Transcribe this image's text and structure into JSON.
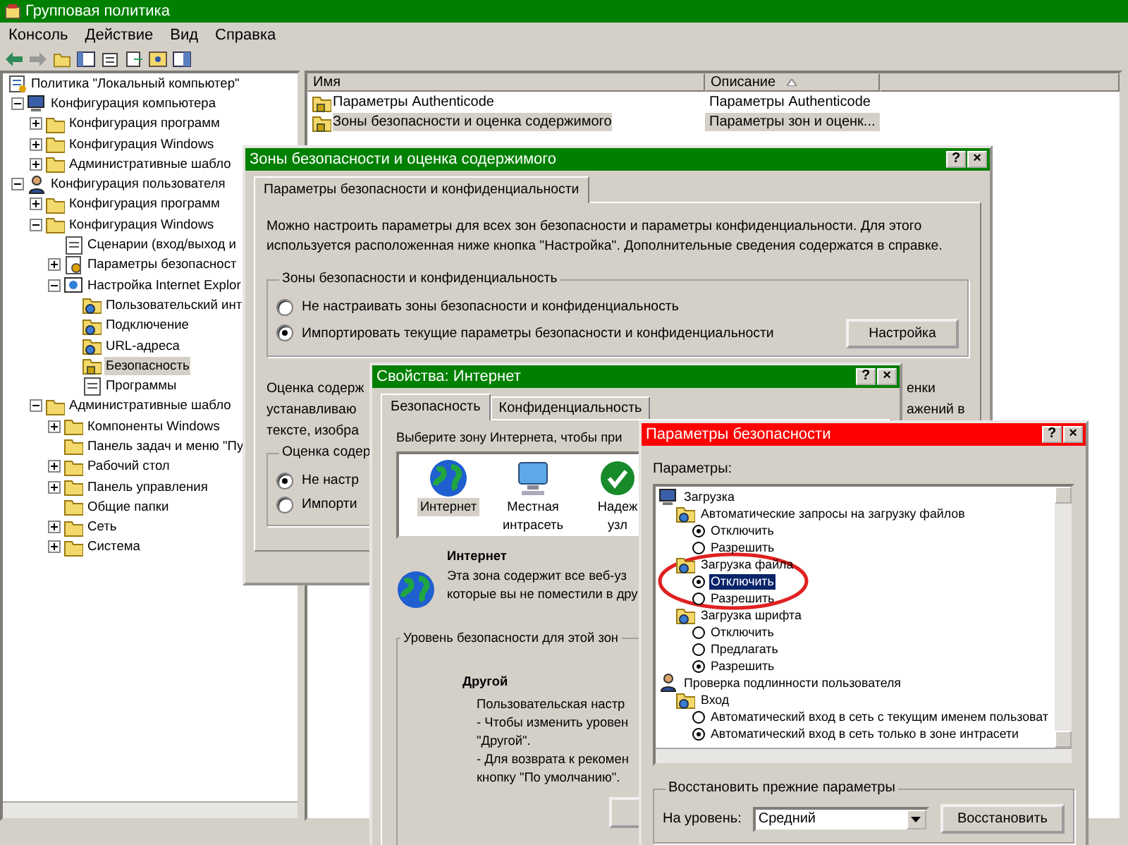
{
  "window": {
    "title": "Групповая политика"
  },
  "menu": [
    "Консоль",
    "Действие",
    "Вид",
    "Справка"
  ],
  "tree": [
    {
      "label": "Политика \"Локальный компьютер\"",
      "children": [
        {
          "label": "Конфигурация компьютера",
          "expanded": true,
          "children": [
            {
              "label": "Конфигурация программ",
              "expanded": false
            },
            {
              "label": "Конфигурация Windows",
              "expanded": false
            },
            {
              "label": "Административные шабло",
              "expanded": false
            }
          ]
        },
        {
          "label": "Конфигурация пользователя",
          "expanded": true,
          "children": [
            {
              "label": "Конфигурация программ",
              "expanded": false
            },
            {
              "label": "Конфигурация Windows",
              "expanded": true,
              "children": [
                {
                  "label": "Сценарии (вход/выход и"
                },
                {
                  "label": "Параметры безопасност",
                  "expanded": false
                },
                {
                  "label": "Настройка Internet Explor",
                  "expanded": true,
                  "children": [
                    {
                      "label": "Пользовательский инт",
                      "selected": false
                    },
                    {
                      "label": "Подключение",
                      "selected": false
                    },
                    {
                      "label": "URL-адреса",
                      "selected": false
                    },
                    {
                      "label": "Безопасность",
                      "selected": true
                    },
                    {
                      "label": "Программы",
                      "selected": false
                    }
                  ]
                }
              ]
            },
            {
              "label": "Административные шабло",
              "expanded": true,
              "children": [
                {
                  "label": "Компоненты Windows",
                  "expanded": false
                },
                {
                  "label": "Панель задач и меню \"Пу"
                },
                {
                  "label": "Рабочий стол",
                  "expanded": false
                },
                {
                  "label": "Панель управления",
                  "expanded": false
                },
                {
                  "label": "Общие папки"
                },
                {
                  "label": "Сеть",
                  "expanded": false
                },
                {
                  "label": "Система",
                  "expanded": false
                }
              ]
            }
          ]
        }
      ]
    }
  ],
  "list": {
    "columns": [
      "Имя",
      "Описание"
    ],
    "rows": [
      {
        "name": "Параметры Authenticode",
        "description": "Параметры Authenticode",
        "selected": false
      },
      {
        "name": "Зоны безопасности и оценка содержимого",
        "description": "Параметры зон и оценк...",
        "selected": true
      }
    ]
  },
  "zones_dialog": {
    "title": "Зоны безопасности и оценка содержимого",
    "title_buttons": [
      "?",
      "×"
    ],
    "tabs": [
      {
        "label": "Параметры безопасности и конфиденциальности",
        "selected": true
      }
    ],
    "intro": "Можно настроить параметры для всех зон безопасности и параметры конфиденциальности. Для этого используется расположенная ниже кнопка \"Настройка\". Дополнительные сведения содержатся в справке.",
    "zones_group": {
      "title": "Зоны безопасности и конфиденциальность",
      "options": [
        {
          "label": "Не настраивать зоны безопасности и конфиденциальность",
          "checked": false
        },
        {
          "label": "Импортировать текущие параметры безопасности и конфиденциальности",
          "checked": true
        }
      ],
      "button": "Настройка"
    },
    "rating_text_left": [
      "Оценка содерж",
      "устанавливаю",
      "тексте, изобра"
    ],
    "rating_text_right": [
      "енки",
      "ажений в"
    ],
    "rating_group": {
      "title": "Оценка содер",
      "options": [
        {
          "label": "Не настр",
          "checked": true
        },
        {
          "label": "Импорти",
          "checked": false
        }
      ]
    }
  },
  "internet_dialog": {
    "title": "Свойства: Интернет",
    "title_buttons": [
      "?",
      "×"
    ],
    "tabs": [
      {
        "label": "Безопасность",
        "selected": true
      },
      {
        "label": "Конфиденциальность",
        "selected": false
      }
    ],
    "prompt": "Выберите зону Интернета, чтобы при",
    "zones": [
      {
        "lines": [
          "Интернет"
        ],
        "selected": true
      },
      {
        "lines": [
          "Местная",
          "интрасеть"
        ],
        "selected": false
      },
      {
        "lines": [
          "Надеж",
          "узл"
        ],
        "selected": false
      }
    ],
    "zone_title": "Интернет",
    "zone_text": [
      "Эта зона содержит все веб-уз",
      "которые вы не поместили в дру"
    ],
    "level_group": {
      "title": "Уровень безопасности для этой зон",
      "level_name": "Другой",
      "lines": [
        "Пользовательская настр",
        "- Чтобы изменить уровен",
        "\"Другой\".",
        "- Для возврата к рекомен",
        "кнопку \"По умолчанию\"."
      ]
    }
  },
  "security_dialog": {
    "title": "Параметры безопасности",
    "title_buttons": [
      "?",
      "×"
    ],
    "label": "Параметры:",
    "settings": [
      {
        "label": "Загрузка",
        "kind": "category",
        "children": [
          {
            "label": "Автоматические запросы на загрузку файлов",
            "kind": "setting",
            "children": [
              {
                "label": "Отключить",
                "kind": "option",
                "checked": true,
                "selected": false
              },
              {
                "label": "Разрешить",
                "kind": "option",
                "checked": false,
                "selected": false
              }
            ]
          },
          {
            "label": "Загрузка файла",
            "kind": "setting",
            "children": [
              {
                "label": "Отключить",
                "kind": "option",
                "checked": true,
                "selected": true
              },
              {
                "label": "Разрешить",
                "kind": "option",
                "checked": false,
                "selected": false
              }
            ]
          },
          {
            "label": "Загрузка шрифта",
            "kind": "setting",
            "children": [
              {
                "label": "Отключить",
                "kind": "option",
                "checked": false,
                "selected": false
              },
              {
                "label": "Предлагать",
                "kind": "option",
                "checked": false,
                "selected": false
              },
              {
                "label": "Разрешить",
                "kind": "option",
                "checked": true,
                "selected": false
              }
            ]
          }
        ]
      },
      {
        "label": "Проверка подлинности пользователя",
        "kind": "category",
        "children": [
          {
            "label": "Вход",
            "kind": "setting",
            "children": [
              {
                "label": "Автоматический вход в сеть с текущим именем пользоват",
                "kind": "option",
                "checked": false,
                "selected": false
              },
              {
                "label": "Автоматический вход в сеть только в зоне интрасети",
                "kind": "option",
                "checked": true,
                "selected": false
              }
            ]
          }
        ]
      }
    ],
    "reset_group": {
      "title": "Восстановить прежние параметры",
      "level_label": "На уровень:",
      "level_value": "Средний",
      "button": "Восстановить"
    }
  }
}
